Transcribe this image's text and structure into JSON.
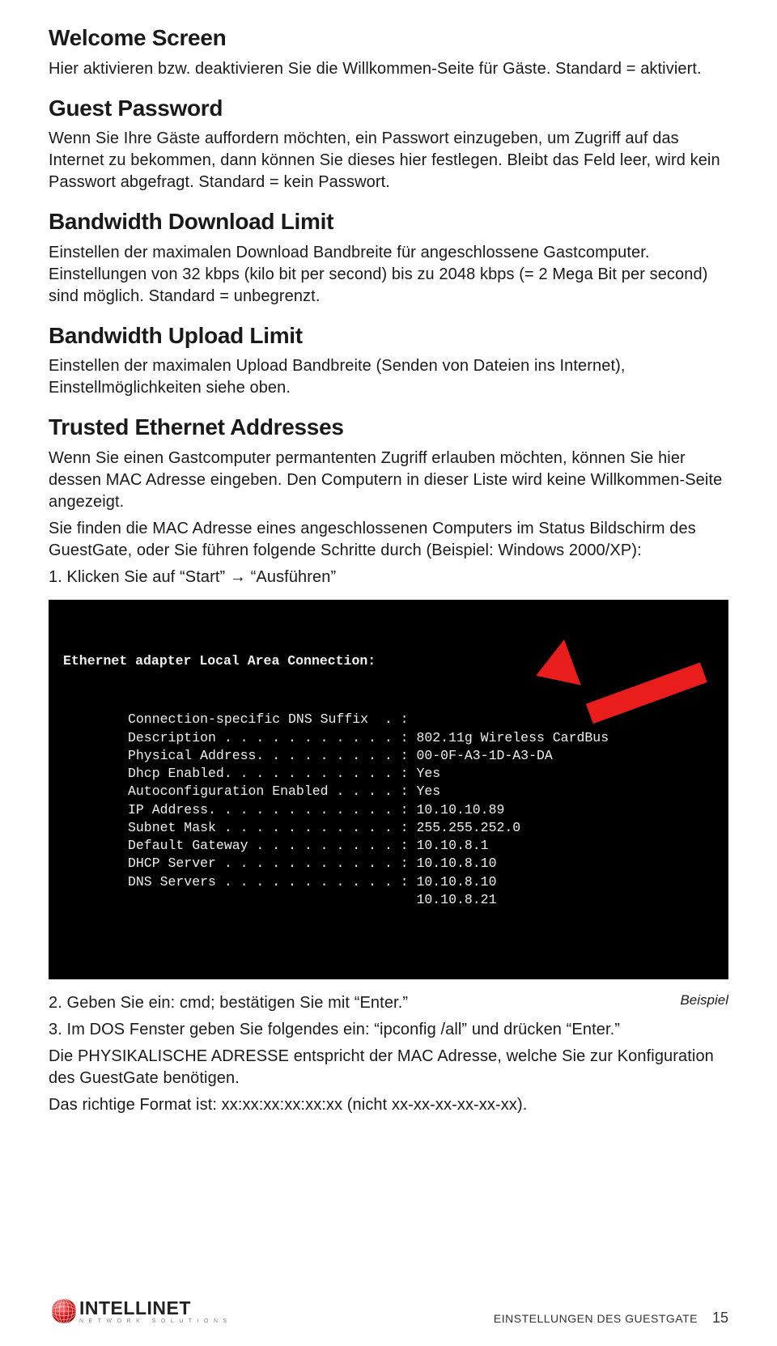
{
  "sections": {
    "welcome": {
      "title": "Welcome Screen",
      "body": "Hier aktivieren bzw. deaktivieren Sie die Willkommen-Seite für Gäste. Standard = aktiviert."
    },
    "guest_password": {
      "title": "Guest Password",
      "body": "Wenn Sie Ihre Gäste auffordern möchten, ein Passwort einzugeben, um Zugriff auf das Internet zu bekommen, dann können Sie dieses hier festlegen. Bleibt das Feld leer, wird kein Passwort abgefragt. Standard = kein Passwort."
    },
    "bw_download": {
      "title": "Bandwidth Download Limit",
      "body": "Einstellen der maximalen Download Bandbreite für angeschlossene Gastcomputer. Einstellungen von 32 kbps (kilo bit per second) bis zu 2048 kbps (= 2 Mega Bit per second) sind möglich. Standard = unbegrenzt."
    },
    "bw_upload": {
      "title": "Bandwidth Upload Limit",
      "body": "Einstellen der maximalen Upload Bandbreite (Senden von Dateien ins Internet), Einstellmöglichkeiten siehe oben."
    },
    "trusted": {
      "title": "Trusted Ethernet Addresses",
      "body1": "Wenn Sie einen Gastcomputer permantenten Zugriff erlauben möchten, können Sie hier dessen MAC Adresse eingeben. Den Computern in dieser Liste wird keine Willkommen-Seite angezeigt.",
      "body2": "Sie finden die MAC Adresse eines angeschlossenen Computers im Status Bildschirm des GuestGate, oder Sie führen folgende Schritte durch (Beispiel: Windows 2000/XP):",
      "step1": "1. Klicken Sie auf “Start” → “Ausführen”",
      "caption": "Beispiel",
      "step2": "2. Geben Sie ein: cmd; bestätigen Sie mit “Enter.”",
      "step3": "3. Im DOS Fenster geben Sie folgendes ein: “ipconfig /all” und drücken “Enter.”",
      "body3": "Die PHYSIKALISCHE ADRESSE entspricht  der MAC Adresse, welche Sie zur Konfiguration des GuestGate benötigen.",
      "body4": "Das richtige Format ist: xx:xx:xx:xx:xx:xx (nicht xx-xx-xx-xx-xx-xx)."
    }
  },
  "terminal": {
    "title": "Ethernet adapter Local Area Connection:",
    "lines": [
      {
        "label": "Connection-specific DNS Suffix  . :",
        "value": ""
      },
      {
        "label": "Description . . . . . . . . . . . :",
        "value": "802.11g Wireless CardBus"
      },
      {
        "label": "Physical Address. . . . . . . . . :",
        "value": "00-0F-A3-1D-A3-DA"
      },
      {
        "label": "Dhcp Enabled. . . . . . . . . . . :",
        "value": "Yes"
      },
      {
        "label": "Autoconfiguration Enabled . . . . :",
        "value": "Yes"
      },
      {
        "label": "IP Address. . . . . . . . . . . . :",
        "value": "10.10.10.89"
      },
      {
        "label": "Subnet Mask . . . . . . . . . . . :",
        "value": "255.255.252.0"
      },
      {
        "label": "Default Gateway . . . . . . . . . :",
        "value": "10.10.8.1"
      },
      {
        "label": "DHCP Server . . . . . . . . . . . :",
        "value": "10.10.8.10"
      },
      {
        "label": "DNS Servers . . . . . . . . . . . :",
        "value": "10.10.8.10"
      },
      {
        "label": "                                   ",
        "value": "10.10.8.21"
      }
    ]
  },
  "footer": {
    "logo_name": "INTELLINET",
    "logo_sub": "NETWORK SOLUTIONS",
    "section": "EINSTELLUNGEN DES GUESTGATE",
    "page": "15"
  }
}
